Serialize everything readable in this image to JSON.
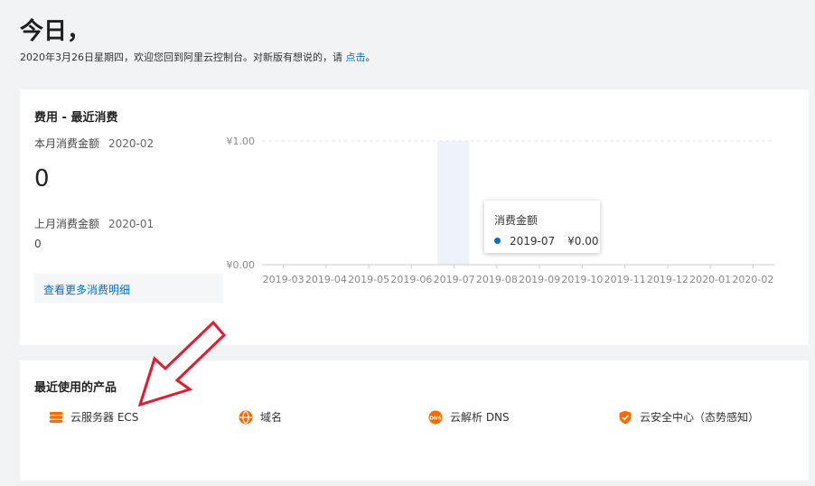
{
  "greeting": {
    "title": "今日，",
    "subtitle_prefix": "2020年3月26日星期四，欢迎您回到阿里云控制台。对新版有想说的，请",
    "subtitle_link": "点击",
    "subtitle_suffix": "。"
  },
  "cost": {
    "title": "费用 - 最近消费",
    "this_month_label": "本月消费金额",
    "this_month_date": "2020-02",
    "this_month_value": "0",
    "last_month_label": "上月消费金额",
    "last_month_date": "2020-01",
    "last_month_value": "0",
    "detail_link": "查看更多消费明细"
  },
  "chart_data": {
    "type": "bar",
    "categories": [
      "2019-03",
      "2019-04",
      "2019-05",
      "2019-06",
      "2019-07",
      "2019-08",
      "2019-09",
      "2019-10",
      "2019-11",
      "2019-12",
      "2020-01",
      "2020-02"
    ],
    "series": [
      {
        "name": "消费金额",
        "values": [
          0,
          0,
          0,
          0,
          0,
          0,
          0,
          0,
          0,
          0,
          0,
          0
        ]
      }
    ],
    "y_tick_labels": [
      "¥0.00",
      "¥1.00"
    ],
    "ylim": [
      0,
      1
    ],
    "grid": "dashed horizontal",
    "highlight_category": "2019-07",
    "tooltip": {
      "title": "消费金额",
      "category": "2019-07",
      "value": "¥0.00"
    },
    "colors": {
      "series": "#0070cc",
      "highlight": "#eef2fb",
      "grid": "#e5e5e5",
      "axis": "#cccccc"
    }
  },
  "products": {
    "title": "最近使用的产品",
    "items": [
      {
        "label": "云服务器 ECS",
        "icon": "ecs-server-icon"
      },
      {
        "label": "域名",
        "icon": "domain-globe-icon"
      },
      {
        "label": "云解析 DNS",
        "icon": "dns-icon"
      },
      {
        "label": "云安全中心（态势感知）",
        "icon": "security-shield-icon"
      }
    ],
    "icon_color": "#ff6a00"
  },
  "annotation": {
    "arrow_color": "#e8192c"
  }
}
